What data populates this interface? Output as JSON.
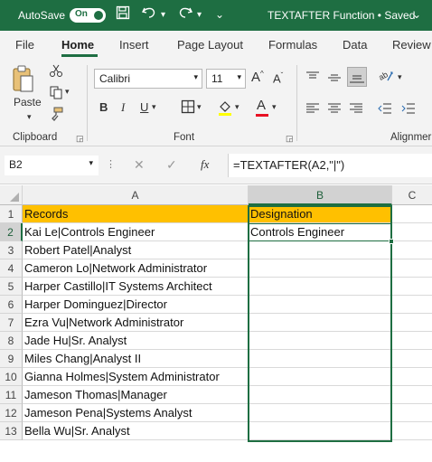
{
  "title_bar": {
    "autosave_label": "AutoSave",
    "autosave_state": "On",
    "document_title": "TEXTAFTER Function • Saved",
    "icons": [
      "save-icon",
      "undo-icon",
      "redo-icon",
      "customize-icon"
    ]
  },
  "tabs": [
    "File",
    "Home",
    "Insert",
    "Page Layout",
    "Formulas",
    "Data",
    "Review"
  ],
  "active_tab": "Home",
  "ribbon": {
    "clipboard": {
      "paste_label": "Paste",
      "group_label": "Clipboard"
    },
    "font": {
      "font_name": "Calibri",
      "font_size": "11",
      "group_label": "Font",
      "font_color": "#e81123"
    },
    "alignment": {
      "group_label": "Alignmer"
    }
  },
  "formula_bar": {
    "name_box": "B2",
    "fx_label": "fx",
    "formula": "=TEXTAFTER(A2,\"|\")"
  },
  "sheet": {
    "columns": [
      "A",
      "B",
      "C"
    ],
    "rows": [
      "1",
      "2",
      "3",
      "4",
      "5",
      "6",
      "7",
      "8",
      "9",
      "10",
      "11",
      "12",
      "13"
    ],
    "header": {
      "a": "Records",
      "b": "Designation"
    },
    "header_color": "#ffc000",
    "records": [
      "Kai Le|Controls Engineer",
      "Robert Patel|Analyst",
      "Cameron Lo|Network Administrator",
      "Harper Castillo|IT Systems Architect",
      "Harper Dominguez|Director",
      "Ezra Vu|Network Administrator",
      "Jade Hu|Sr. Analyst",
      "Miles Chang|Analyst II",
      "Gianna Holmes|System Administrator",
      "Jameson Thomas|Manager",
      "Jameson Pena|Systems Analyst",
      "Bella Wu|Sr. Analyst"
    ],
    "designations": [
      "Controls Engineer",
      "",
      "",
      "",
      "",
      "",
      "",
      "",
      "",
      "",
      "",
      ""
    ],
    "selected_cell": "B2",
    "accent": "#1e6e42"
  }
}
